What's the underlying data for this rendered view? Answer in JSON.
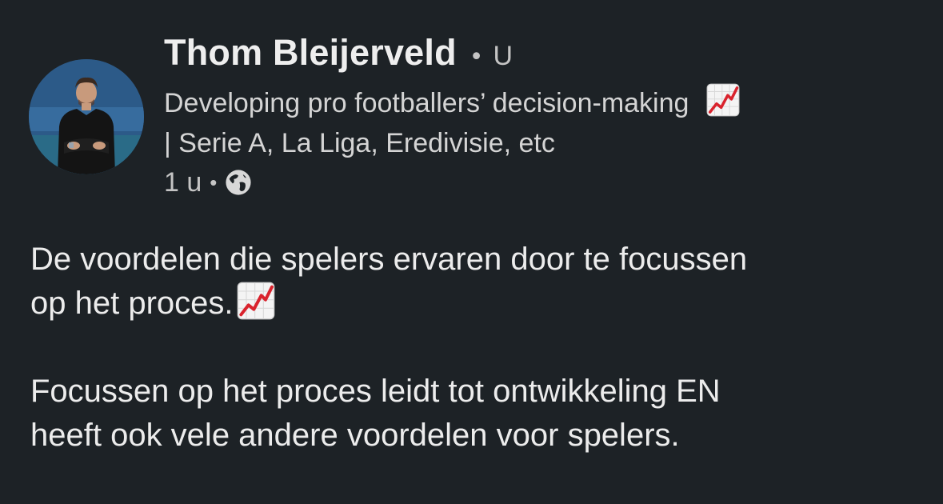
{
  "author": {
    "name": "Thom Bleijerveld",
    "degree": "U",
    "headline_line1": "Developing pro footballers’ decision-making",
    "headline_line2": "| Serie A, La Liga, Eredivisie, etc",
    "headline_icon": "chart-increasing-icon"
  },
  "meta": {
    "time": "1 u",
    "visibility_icon": "globe-icon"
  },
  "post": {
    "paragraph1_line1": "De voordelen die spelers ervaren door te focussen",
    "paragraph1_line2": "op het proces.",
    "paragraph1_icon": "chart-increasing-icon",
    "paragraph2_line1": "Focussen op het proces leidt tot ontwikkeling EN",
    "paragraph2_line2": "heeft ook vele andere voordelen voor spelers."
  },
  "colors": {
    "background": "#1d2226",
    "text": "#e9e9e9",
    "muted": "#c4c4c4",
    "chart_line": "#d9232d"
  }
}
